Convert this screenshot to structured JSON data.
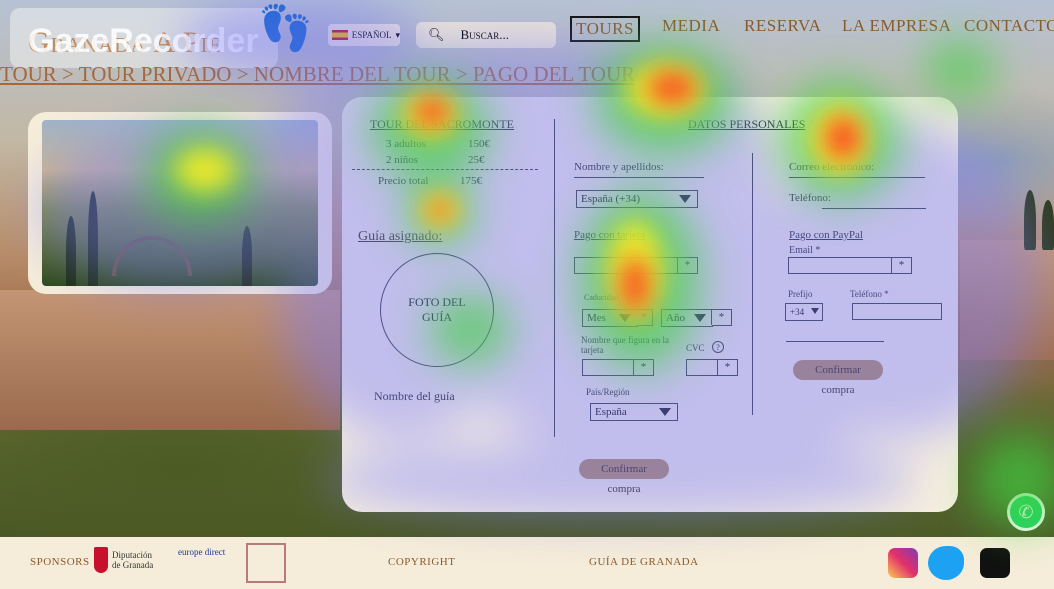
{
  "header": {
    "logo_text": "Granada A Pie",
    "watermark": "GazeRecorder",
    "language": "ESPAÑOL",
    "search_placeholder": "Buscar...",
    "nav": [
      "TOURS",
      "MEDIA",
      "RESERVA",
      "LA EMPRESA",
      "CONTACTO"
    ]
  },
  "breadcrumb": [
    "TOUR",
    "TOUR PRIVADO",
    "NOMBRE DEL TOUR",
    "PAGO DEL TOUR"
  ],
  "tour": {
    "title": "TOUR DEL SACROMONTE",
    "adults_label": "3 adultos",
    "adults_price": "150€",
    "children_label": "2 niños",
    "children_price": "25€",
    "total_label": "Precio total",
    "total_price": "175€",
    "guide_heading": "Guía asignado:",
    "guide_photo": "FOTO DEL GUÍA",
    "guide_name": "Nombre del guía"
  },
  "personal": {
    "heading": "DATOS PERSONALES",
    "name_label": "Nombre y apellidos:",
    "email_label": "Correo electrónico:",
    "phone_label": "Teléfono:",
    "country_code": "España (+34)"
  },
  "card": {
    "heading": "Pago con tarjeta",
    "required": "*",
    "expiry_label": "Caducidad",
    "month": "Mes",
    "year": "Año",
    "holder_label": "Nombre que figura en la tarjeta",
    "cvc_label": "CVC",
    "cvc_help": "?",
    "region_label": "País/Región",
    "country": "España",
    "confirm": "Confirmar compra"
  },
  "paypal": {
    "heading": "Pago con PayPal",
    "email_label": "Email *",
    "prefix_label": "Prefijo",
    "phone_label": "Teléfono *",
    "prefix_value": "+34",
    "confirm": "Confirmar compra"
  },
  "footer": {
    "sponsors": "SPONSORS",
    "sponsor1": "Diputación de Granada",
    "sponsor2": "europe direct",
    "copyright": "COPYRIGHT",
    "guide": "GUÍA DE GRANADA"
  },
  "colors": {
    "accent": "#8b5a2b",
    "panel": "#f6efdf",
    "button": "#b08a55"
  }
}
